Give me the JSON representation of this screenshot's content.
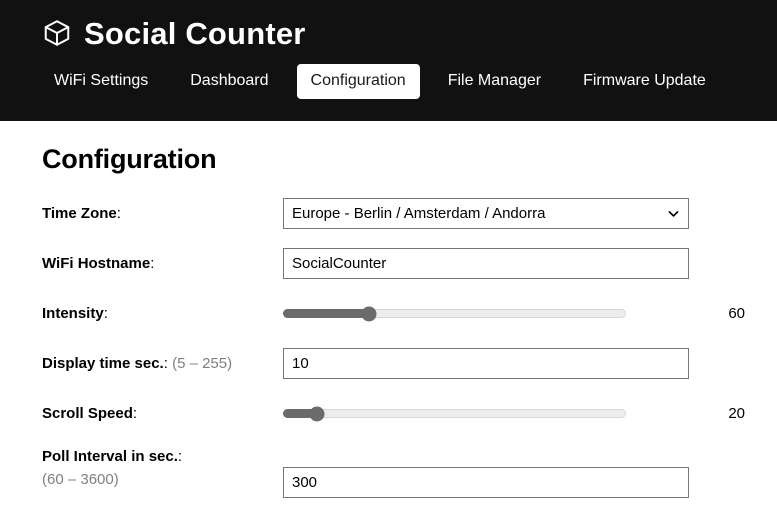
{
  "header": {
    "brand_icon": "cube-icon",
    "title": "Social Counter",
    "tabs": [
      {
        "label": "WiFi Settings",
        "active": false
      },
      {
        "label": "Dashboard",
        "active": false
      },
      {
        "label": "Configuration",
        "active": true
      },
      {
        "label": "File Manager",
        "active": false
      },
      {
        "label": "Firmware Update",
        "active": false
      }
    ]
  },
  "main": {
    "page_title": "Configuration",
    "fields": {
      "timezone": {
        "label": "Time Zone",
        "colon": ":",
        "value": "Europe - Berlin / Amsterdam / Andorra",
        "options": [
          "Europe - Berlin / Amsterdam / Andorra"
        ],
        "arrow_icon": "chevron-down-icon"
      },
      "hostname": {
        "label": "WiFi Hostname",
        "colon": ":",
        "value": "SocialCounter"
      },
      "intensity": {
        "label": "Intensity",
        "colon": ":",
        "value": "60",
        "percent": 25
      },
      "display_time": {
        "label": "Display time sec.",
        "colon": ":",
        "hint": "(5 – 255)",
        "value": "10"
      },
      "scroll_speed": {
        "label": "Scroll Speed",
        "colon": ":",
        "value": "20",
        "percent": 10
      },
      "poll_interval": {
        "label": "Poll Interval in sec.",
        "colon": ":",
        "hint": "(60 – 3600)",
        "value": "300"
      }
    }
  },
  "colors": {
    "header_bg": "#111111",
    "header_text": "#ffffff",
    "active_tab_bg": "#ffffff",
    "active_tab_text": "#1a1a1a",
    "body_bg": "#ffffff",
    "text": "#000000",
    "hint_text": "#808080",
    "input_border": "#767676",
    "slider_fill": "#6b6b6b",
    "slider_track": "#eceded"
  }
}
